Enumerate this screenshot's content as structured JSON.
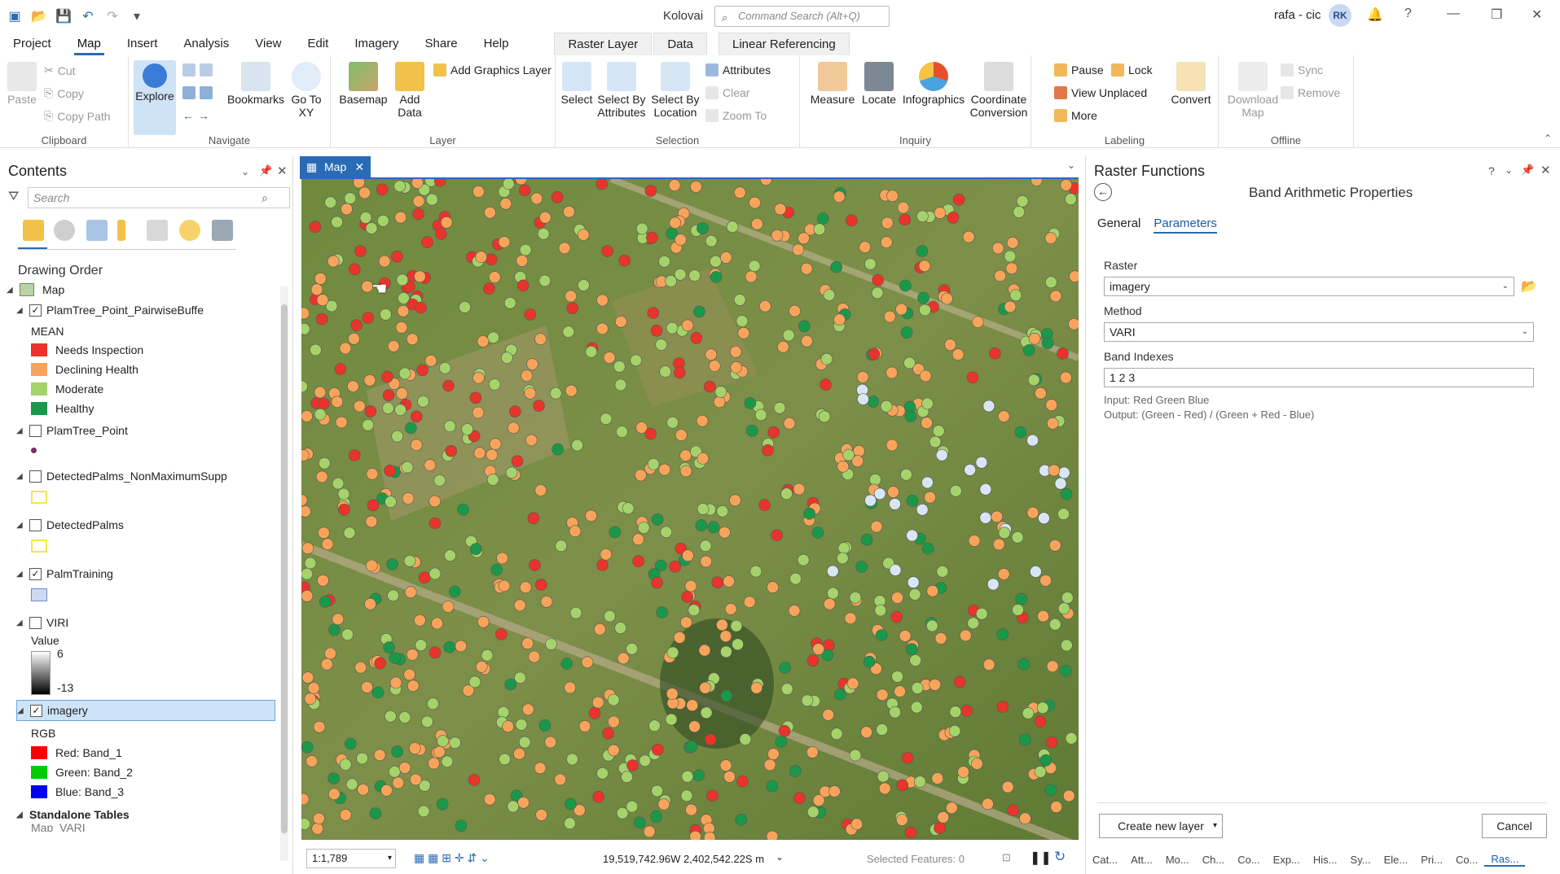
{
  "app": {
    "title": "Kolovai",
    "command_search_placeholder": "Command Search (Alt+Q)",
    "user": "rafa - cic",
    "avatar": "RK"
  },
  "tabs": [
    "Project",
    "Map",
    "Insert",
    "Analysis",
    "View",
    "Edit",
    "Imagery",
    "Share",
    "Help"
  ],
  "context_tabs": [
    "Raster Layer",
    "Data",
    "Linear Referencing"
  ],
  "ribbon": {
    "clipboard": {
      "label": "Clipboard",
      "paste": "Paste",
      "cut": "Cut",
      "copy": "Copy",
      "copy_path": "Copy Path"
    },
    "navigate": {
      "label": "Navigate",
      "explore": "Explore",
      "bookmarks": "Bookmarks",
      "go_to_xy": "Go To XY"
    },
    "layer": {
      "label": "Layer",
      "basemap": "Basemap",
      "add_data": "Add Data",
      "add_graphics_layer": "Add Graphics Layer"
    },
    "selection": {
      "label": "Selection",
      "select": "Select",
      "select_by_attributes": "Select By Attributes",
      "select_by_location": "Select By Location",
      "attributes": "Attributes",
      "clear": "Clear",
      "zoom_to": "Zoom To"
    },
    "inquiry": {
      "label": "Inquiry",
      "measure": "Measure",
      "locate": "Locate",
      "infographics": "Infographics",
      "coordinate_conversion": "Coordinate Conversion"
    },
    "labeling": {
      "label": "Labeling",
      "pause": "Pause",
      "lock": "Lock",
      "view_unplaced": "View Unplaced",
      "more": "More",
      "convert": "Convert"
    },
    "offline": {
      "label": "Offline",
      "download_map": "Download Map",
      "sync": "Sync",
      "remove": "Remove"
    }
  },
  "contents": {
    "title": "Contents",
    "search_placeholder": "Search",
    "drawing_order": "Drawing Order",
    "layers": [
      {
        "name": "Map"
      },
      {
        "name": "PlamTree_Point_PairwiseBuffe",
        "checked": true,
        "field": "MEAN",
        "legend": [
          {
            "label": "Needs Inspection",
            "color": "#e8342b"
          },
          {
            "label": "Declining Health",
            "color": "#f7a45a"
          },
          {
            "label": "Moderate",
            "color": "#a5d36a"
          },
          {
            "label": "Healthy",
            "color": "#1a9849"
          }
        ]
      },
      {
        "name": "PlamTree_Point",
        "checked": false
      },
      {
        "name": "DetectedPalms_NonMaximumSupp",
        "checked": false
      },
      {
        "name": "DetectedPalms",
        "checked": false
      },
      {
        "name": "PalmTraining",
        "checked": true
      },
      {
        "name": "VIRI",
        "checked": false,
        "field": "Value",
        "max": "6",
        "min": "-13"
      },
      {
        "name": "imagery",
        "checked": true,
        "field": "RGB",
        "bands": [
          {
            "label": "Red:  Band_1",
            "color": "#ff0000"
          },
          {
            "label": "Green: Band_2",
            "color": "#00cc00"
          },
          {
            "label": "Blue:  Band_3",
            "color": "#0000ee"
          }
        ]
      },
      {
        "name": "Standalone Tables"
      },
      {
        "name": "Map_VARI"
      }
    ]
  },
  "map": {
    "tab": "Map",
    "scale": "1:1,789",
    "coords": "19,519,742.96W 2,402,542.22S m",
    "selected_features": "Selected Features: 0"
  },
  "raster_functions": {
    "title": "Raster Functions",
    "subtitle": "Band Arithmetic Properties",
    "tabs": [
      "General",
      "Parameters"
    ],
    "raster_label": "Raster",
    "raster_value": "imagery",
    "method_label": "Method",
    "method_value": "VARI",
    "band_label": "Band Indexes",
    "band_value": "1 2 3",
    "input_info": "Input: Red Green Blue",
    "output_info": "Output: (Green - Red) / (Green + Red - Blue)",
    "create_button": "Create new layer",
    "cancel_button": "Cancel",
    "bottom_tabs": [
      "Cat...",
      "Att...",
      "Mo...",
      "Ch...",
      "Co...",
      "Exp...",
      "His...",
      "Sy...",
      "Ele...",
      "Pri...",
      "Co...",
      "Ras..."
    ]
  }
}
